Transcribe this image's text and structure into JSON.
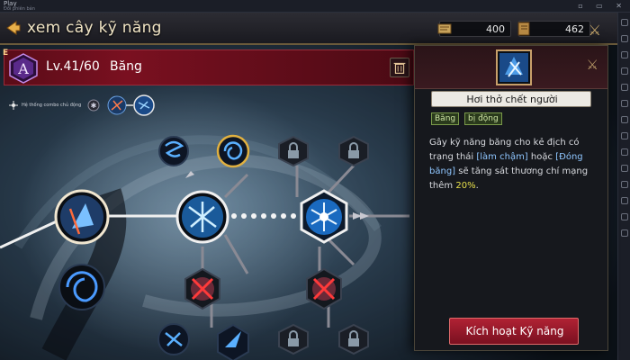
{
  "emulator": {
    "title": "Play",
    "subtitle": "Đổi phiên bản"
  },
  "header": {
    "title": "xem cây kỹ năng",
    "currency_1": "400",
    "currency_2": "462"
  },
  "class_bar": {
    "tier_letter": "A",
    "tier_corner": "E",
    "level": "Lv.41/60",
    "class_name": "Băng"
  },
  "combo": {
    "label": "Hệ thống combo chủ động"
  },
  "skill_detail": {
    "name": "Hơi thở chết người",
    "tags": [
      "Băng",
      "bị động"
    ],
    "description_parts": [
      {
        "text": "Gây kỹ năng băng cho kẻ địch có trạng thái ",
        "style": "normal"
      },
      {
        "text": "[làm chậm]",
        "style": "keyword"
      },
      {
        "text": " hoặc ",
        "style": "normal"
      },
      {
        "text": "[Đóng băng]",
        "style": "keyword"
      },
      {
        "text": " sẽ tăng sát thương chí mạng thêm ",
        "style": "normal"
      },
      {
        "text": "20%",
        "style": "highlight"
      },
      {
        "text": ".",
        "style": "normal"
      }
    ],
    "activate_label": "Kích hoạt Kỹ năng"
  },
  "skill_nodes": [
    {
      "name": "skill-node-tornado",
      "icon": "tornado",
      "state": "unlocked",
      "size": "small"
    },
    {
      "name": "skill-node-swirl-gold",
      "icon": "swirl",
      "state": "selected-gold",
      "size": "small"
    },
    {
      "name": "skill-node-lock-top-1",
      "icon": "lock",
      "state": "locked",
      "size": "small"
    },
    {
      "name": "skill-node-lock-top-2",
      "icon": "lock",
      "state": "locked",
      "size": "small"
    },
    {
      "name": "skill-node-root",
      "icon": "frost-warrior",
      "state": "unlocked",
      "size": "large"
    },
    {
      "name": "skill-node-ice-burst",
      "icon": "ice-burst",
      "state": "unlocked",
      "size": "large"
    },
    {
      "name": "skill-node-snowflake",
      "icon": "snowflake",
      "state": "selected",
      "size": "large"
    },
    {
      "name": "skill-node-vortex",
      "icon": "vortex",
      "state": "unlocked",
      "size": "large"
    },
    {
      "name": "skill-node-crossed-1",
      "icon": "crossed",
      "state": "disabled",
      "size": "medium"
    },
    {
      "name": "skill-node-crossed-2",
      "icon": "crossed",
      "state": "disabled",
      "size": "medium"
    },
    {
      "name": "skill-node-bottom-1",
      "icon": "frost",
      "state": "unlocked",
      "size": "small"
    },
    {
      "name": "skill-node-bottom-2",
      "icon": "shard",
      "state": "unlocked",
      "size": "small"
    },
    {
      "name": "skill-node-lock-bottom-1",
      "icon": "lock",
      "state": "locked",
      "size": "small"
    },
    {
      "name": "skill-node-lock-bottom-2",
      "icon": "lock",
      "state": "locked",
      "size": "small"
    }
  ],
  "colors": {
    "accent_red": "#b02234",
    "ice_blue": "#5ab0ff",
    "gold": "#e0b040",
    "highlight_yellow": "#e8e04a",
    "keyword_blue": "#8fc6ff"
  }
}
